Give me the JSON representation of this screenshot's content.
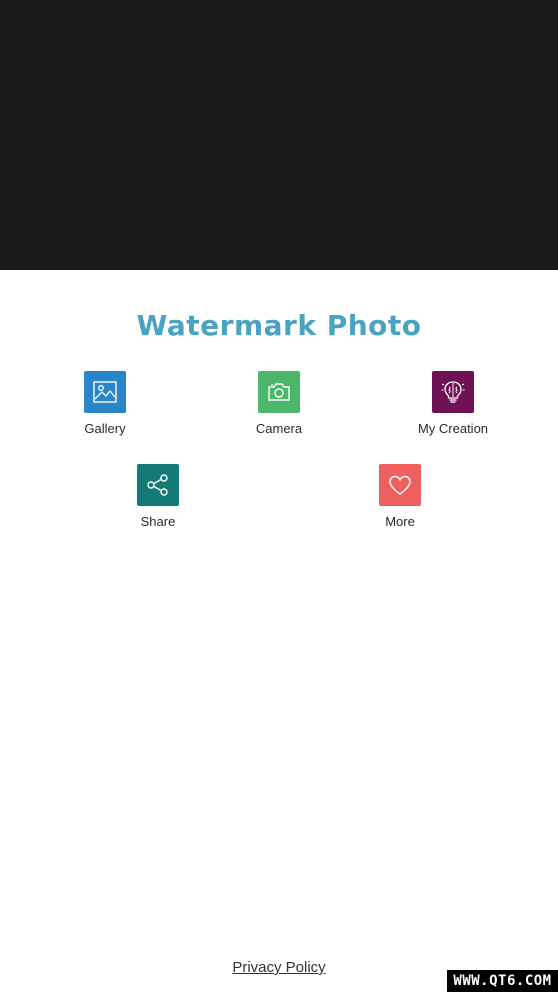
{
  "app": {
    "title": "Watermark Photo"
  },
  "menu": {
    "items": [
      {
        "label": "Gallery",
        "icon": "image-icon",
        "color": "#2a86c6"
      },
      {
        "label": "Camera",
        "icon": "camera-icon",
        "color": "#4cb76b"
      },
      {
        "label": "My Creation",
        "icon": "brain-bulb-icon",
        "color": "#6e1155"
      },
      {
        "label": "Share",
        "icon": "share-icon",
        "color": "#147a78"
      },
      {
        "label": "More",
        "icon": "heart-icon",
        "color": "#ef5f5f"
      }
    ]
  },
  "footer": {
    "privacy_label": "Privacy Policy"
  },
  "overlay": {
    "watermark_text": "WWW.QT6.COM"
  },
  "colors": {
    "title": "#4aa3c2",
    "top_background": "#1a1a1a"
  }
}
